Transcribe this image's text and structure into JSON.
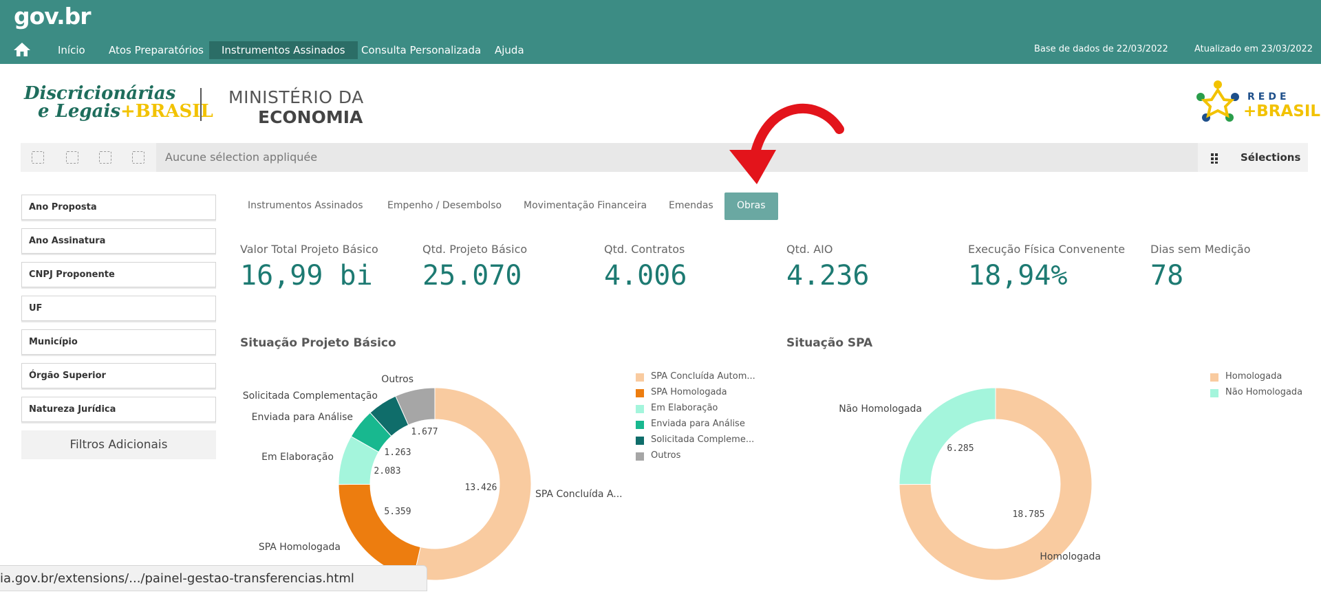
{
  "header": {
    "logo": "gov.br",
    "nav": [
      {
        "label": "Início"
      },
      {
        "label": "Atos Preparatórios"
      },
      {
        "label": "Instrumentos Assinados"
      },
      {
        "label": "Consulta Personalizada"
      },
      {
        "label": "Ajuda"
      }
    ],
    "base_dados": "Base de dados de 22/03/2022",
    "atualizado": "Atualizado em 23/03/2022",
    "colors": {
      "bar": "#3c8c84",
      "active_nav": "#2b6d66"
    }
  },
  "brand": {
    "line1": "Discricionárias",
    "line2": "e Legais",
    "plus_brasil": "+BRASIL",
    "ministry_line1": "MINISTÉRIO DA",
    "ministry_line2": "ECONOMIA",
    "rede_line1": "REDE",
    "rede_line2": "+BRASIL"
  },
  "selections": {
    "empty_text": "Aucune sélection appliquée",
    "button_label": "Sélections"
  },
  "filters": {
    "items": [
      {
        "label": "Ano Proposta"
      },
      {
        "label": "Ano Assinatura"
      },
      {
        "label": "CNPJ Proponente"
      },
      {
        "label": "UF"
      },
      {
        "label": "Município"
      },
      {
        "label": "Órgão Superior"
      },
      {
        "label": "Natureza Jurídica"
      }
    ],
    "more_label": "Filtros Adicionais"
  },
  "tabs": [
    {
      "label": "Instrumentos Assinados"
    },
    {
      "label": "Empenho / Desembolso"
    },
    {
      "label": "Movimentação Financeira"
    },
    {
      "label": "Emendas"
    },
    {
      "label": "Obras",
      "active": true
    }
  ],
  "kpis": [
    {
      "label": "Valor Total Projeto Básico",
      "value": "16,99 bi"
    },
    {
      "label": "Qtd. Projeto Básico",
      "value": "25.070"
    },
    {
      "label": "Qtd. Contratos",
      "value": "4.006"
    },
    {
      "label": "Qtd. AIO",
      "value": "4.236"
    },
    {
      "label": "Execução Física Convenente",
      "value": "18,94%"
    },
    {
      "label": "Dias sem Medição",
      "value": "78"
    }
  ],
  "chart_data": [
    {
      "type": "pie",
      "title": "Situação Projeto Básico",
      "slices": [
        {
          "label": "SPA Concluída A...",
          "legend": "SPA Concluída Autom...",
          "value": 13426,
          "display": "13.426",
          "color": "#f9cba0"
        },
        {
          "label": "SPA Homologada",
          "legend": "SPA Homologada",
          "value": 5359,
          "display": "5.359",
          "color": "#ed7d0f"
        },
        {
          "label": "Em Elaboração",
          "legend": "Em Elaboração",
          "value": 2083,
          "display": "2.083",
          "color": "#a4f5dc"
        },
        {
          "label": "Enviada para Análise",
          "legend": "Enviada para Análise",
          "value": 1263,
          "display": "1.263",
          "color": "#18b88f"
        },
        {
          "label": "Solicitada Complementação",
          "legend": "Solicitada Compleme...",
          "value": 1262,
          "display": "",
          "color": "#0f6d6a"
        },
        {
          "label": "Outros",
          "legend": "Outros",
          "value": 1677,
          "display": "1.677",
          "color": "#a6a6a6"
        }
      ]
    },
    {
      "type": "pie",
      "title": "Situação SPA",
      "slices": [
        {
          "label": "Homologada",
          "legend": "Homologada",
          "value": 18785,
          "display": "18.785",
          "color": "#f9cba0"
        },
        {
          "label": "Não Homologada",
          "legend": "Não Homologada",
          "value": 6285,
          "display": "6.285",
          "color": "#a4f5dc"
        }
      ]
    }
  ],
  "status_bar": {
    "url": "ia.gov.br/extensions/.../painel-gestao-transferencias.html"
  }
}
